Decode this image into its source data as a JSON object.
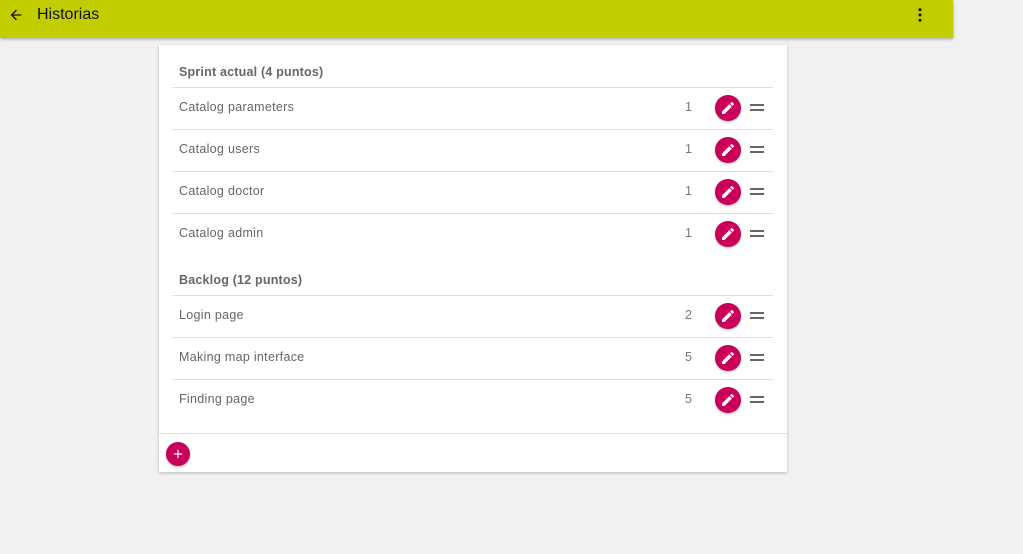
{
  "app": {
    "title": "Historias",
    "toolbar_color": "#c2cd00",
    "accent_color": "#c8005a"
  },
  "toolbar": {
    "back_icon": "arrow-back-icon",
    "more_icon": "more-vert-icon"
  },
  "sprint": {
    "header": "Sprint actual (4 puntos)",
    "stories": [
      {
        "name": "Catalog parameters",
        "points": "1"
      },
      {
        "name": "Catalog users",
        "points": "1"
      },
      {
        "name": "Catalog doctor",
        "points": "1"
      },
      {
        "name": "Catalog admin",
        "points": "1"
      }
    ]
  },
  "backlog": {
    "header": "Backlog (12 puntos)",
    "stories": [
      {
        "name": "Login page",
        "points": "2"
      },
      {
        "name": "Making map interface",
        "points": "5"
      },
      {
        "name": "Finding page",
        "points": "5"
      }
    ]
  },
  "footer": {
    "add_icon": "add-icon"
  }
}
